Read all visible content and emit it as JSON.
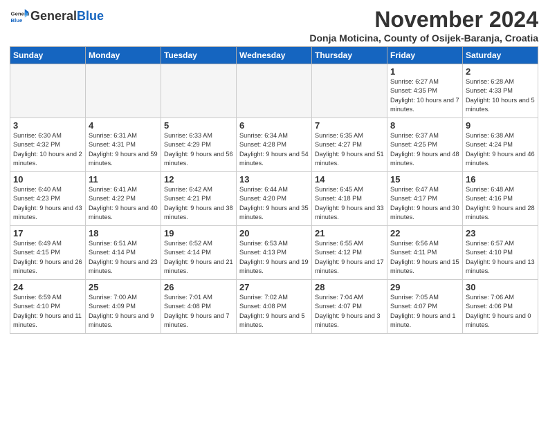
{
  "header": {
    "logo_general": "General",
    "logo_blue": "Blue",
    "month_title": "November 2024",
    "subtitle": "Donja Moticina, County of Osijek-Baranja, Croatia"
  },
  "weekdays": [
    "Sunday",
    "Monday",
    "Tuesday",
    "Wednesday",
    "Thursday",
    "Friday",
    "Saturday"
  ],
  "weeks": [
    [
      {
        "day": "",
        "info": ""
      },
      {
        "day": "",
        "info": ""
      },
      {
        "day": "",
        "info": ""
      },
      {
        "day": "",
        "info": ""
      },
      {
        "day": "",
        "info": ""
      },
      {
        "day": "1",
        "info": "Sunrise: 6:27 AM\nSunset: 4:35 PM\nDaylight: 10 hours and 7 minutes."
      },
      {
        "day": "2",
        "info": "Sunrise: 6:28 AM\nSunset: 4:33 PM\nDaylight: 10 hours and 5 minutes."
      }
    ],
    [
      {
        "day": "3",
        "info": "Sunrise: 6:30 AM\nSunset: 4:32 PM\nDaylight: 10 hours and 2 minutes."
      },
      {
        "day": "4",
        "info": "Sunrise: 6:31 AM\nSunset: 4:31 PM\nDaylight: 9 hours and 59 minutes."
      },
      {
        "day": "5",
        "info": "Sunrise: 6:33 AM\nSunset: 4:29 PM\nDaylight: 9 hours and 56 minutes."
      },
      {
        "day": "6",
        "info": "Sunrise: 6:34 AM\nSunset: 4:28 PM\nDaylight: 9 hours and 54 minutes."
      },
      {
        "day": "7",
        "info": "Sunrise: 6:35 AM\nSunset: 4:27 PM\nDaylight: 9 hours and 51 minutes."
      },
      {
        "day": "8",
        "info": "Sunrise: 6:37 AM\nSunset: 4:25 PM\nDaylight: 9 hours and 48 minutes."
      },
      {
        "day": "9",
        "info": "Sunrise: 6:38 AM\nSunset: 4:24 PM\nDaylight: 9 hours and 46 minutes."
      }
    ],
    [
      {
        "day": "10",
        "info": "Sunrise: 6:40 AM\nSunset: 4:23 PM\nDaylight: 9 hours and 43 minutes."
      },
      {
        "day": "11",
        "info": "Sunrise: 6:41 AM\nSunset: 4:22 PM\nDaylight: 9 hours and 40 minutes."
      },
      {
        "day": "12",
        "info": "Sunrise: 6:42 AM\nSunset: 4:21 PM\nDaylight: 9 hours and 38 minutes."
      },
      {
        "day": "13",
        "info": "Sunrise: 6:44 AM\nSunset: 4:20 PM\nDaylight: 9 hours and 35 minutes."
      },
      {
        "day": "14",
        "info": "Sunrise: 6:45 AM\nSunset: 4:18 PM\nDaylight: 9 hours and 33 minutes."
      },
      {
        "day": "15",
        "info": "Sunrise: 6:47 AM\nSunset: 4:17 PM\nDaylight: 9 hours and 30 minutes."
      },
      {
        "day": "16",
        "info": "Sunrise: 6:48 AM\nSunset: 4:16 PM\nDaylight: 9 hours and 28 minutes."
      }
    ],
    [
      {
        "day": "17",
        "info": "Sunrise: 6:49 AM\nSunset: 4:15 PM\nDaylight: 9 hours and 26 minutes."
      },
      {
        "day": "18",
        "info": "Sunrise: 6:51 AM\nSunset: 4:14 PM\nDaylight: 9 hours and 23 minutes."
      },
      {
        "day": "19",
        "info": "Sunrise: 6:52 AM\nSunset: 4:14 PM\nDaylight: 9 hours and 21 minutes."
      },
      {
        "day": "20",
        "info": "Sunrise: 6:53 AM\nSunset: 4:13 PM\nDaylight: 9 hours and 19 minutes."
      },
      {
        "day": "21",
        "info": "Sunrise: 6:55 AM\nSunset: 4:12 PM\nDaylight: 9 hours and 17 minutes."
      },
      {
        "day": "22",
        "info": "Sunrise: 6:56 AM\nSunset: 4:11 PM\nDaylight: 9 hours and 15 minutes."
      },
      {
        "day": "23",
        "info": "Sunrise: 6:57 AM\nSunset: 4:10 PM\nDaylight: 9 hours and 13 minutes."
      }
    ],
    [
      {
        "day": "24",
        "info": "Sunrise: 6:59 AM\nSunset: 4:10 PM\nDaylight: 9 hours and 11 minutes."
      },
      {
        "day": "25",
        "info": "Sunrise: 7:00 AM\nSunset: 4:09 PM\nDaylight: 9 hours and 9 minutes."
      },
      {
        "day": "26",
        "info": "Sunrise: 7:01 AM\nSunset: 4:08 PM\nDaylight: 9 hours and 7 minutes."
      },
      {
        "day": "27",
        "info": "Sunrise: 7:02 AM\nSunset: 4:08 PM\nDaylight: 9 hours and 5 minutes."
      },
      {
        "day": "28",
        "info": "Sunrise: 7:04 AM\nSunset: 4:07 PM\nDaylight: 9 hours and 3 minutes."
      },
      {
        "day": "29",
        "info": "Sunrise: 7:05 AM\nSunset: 4:07 PM\nDaylight: 9 hours and 1 minute."
      },
      {
        "day": "30",
        "info": "Sunrise: 7:06 AM\nSunset: 4:06 PM\nDaylight: 9 hours and 0 minutes."
      }
    ]
  ]
}
